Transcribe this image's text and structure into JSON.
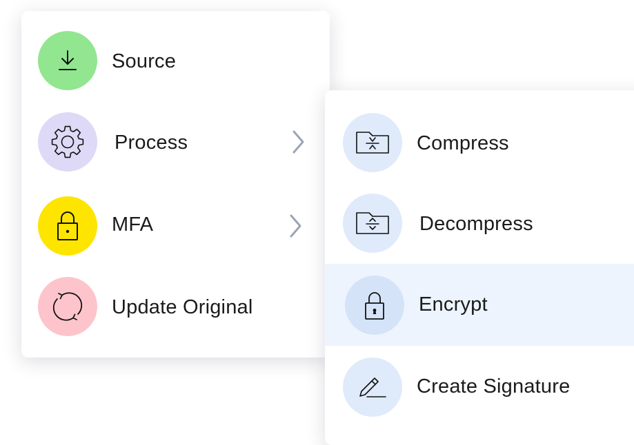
{
  "main_menu": {
    "items": [
      {
        "label": "Source",
        "icon": "download-icon",
        "color": "#91e68f"
      },
      {
        "label": "Process",
        "icon": "gear-icon",
        "color": "#ddd9f7",
        "has_submenu": true
      },
      {
        "label": "MFA",
        "icon": "padlock-icon",
        "color": "#fde500",
        "has_submenu": true
      },
      {
        "label": "Update Original",
        "icon": "refresh-icon",
        "color": "#fdc4cb"
      }
    ]
  },
  "sub_menu": {
    "items": [
      {
        "label": "Compress",
        "icon": "compress-folder-icon",
        "color": "#dfeafb"
      },
      {
        "label": "Decompress",
        "icon": "decompress-folder-icon",
        "color": "#dfeafb"
      },
      {
        "label": "Encrypt",
        "icon": "lock-icon",
        "color": "#d4e3f8",
        "highlighted": true
      },
      {
        "label": "Create Signature",
        "icon": "pen-icon",
        "color": "#dfeafb"
      }
    ]
  },
  "colors": {
    "chevron": "#9aa4b5",
    "highlight_row": "#edf4fd",
    "text": "#1b1b1b"
  }
}
